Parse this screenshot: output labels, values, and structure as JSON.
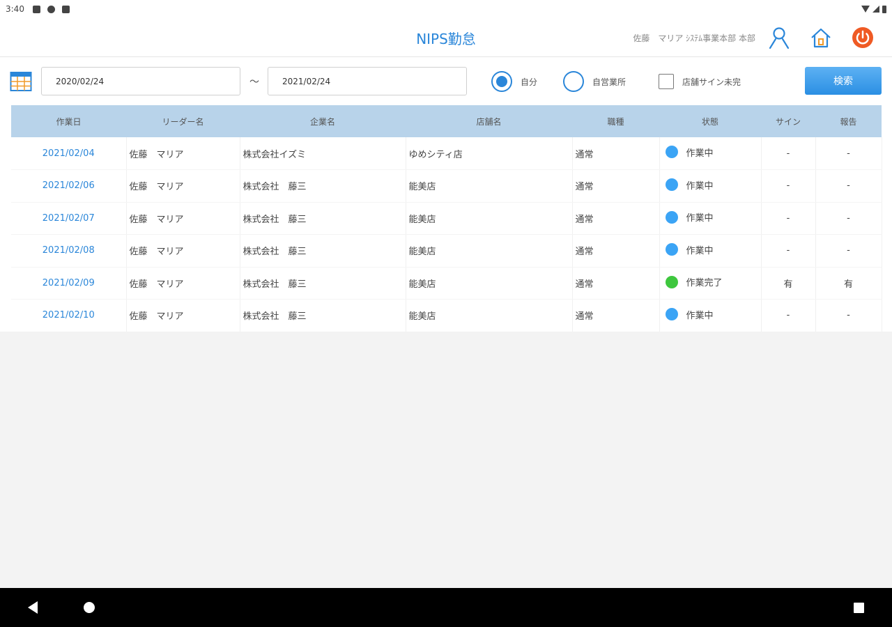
{
  "status_bar": {
    "time": "3:40"
  },
  "header": {
    "title": "NIPS勤怠",
    "user_info": "佐藤　マリア ｼｽﾃﾑ事業本部 本部"
  },
  "filter": {
    "date_from": "2020/02/24",
    "date_separator": "～",
    "date_to": "2021/02/24",
    "radio_self_label": "自分",
    "radio_office_label": "自営業所",
    "checkbox_label": "店舗サイン未完",
    "search_label": "検索"
  },
  "table": {
    "headers": [
      "作業日",
      "リーダー名",
      "企業名",
      "店舗名",
      "職種",
      "状態",
      "サイン",
      "報告"
    ],
    "rows": [
      {
        "date": "2021/02/04",
        "leader": "佐藤　マリア",
        "company": "株式会社イズミ",
        "store": "ゆめシティ店",
        "type": "通常",
        "status": "作業中",
        "sign": "-",
        "report": "-"
      },
      {
        "date": "2021/02/06",
        "leader": "佐藤　マリア",
        "company": "株式会社　藤三",
        "store": "能美店",
        "type": "通常",
        "status": "作業中",
        "sign": "-",
        "report": "-"
      },
      {
        "date": "2021/02/07",
        "leader": "佐藤　マリア",
        "company": "株式会社　藤三",
        "store": "能美店",
        "type": "通常",
        "status": "作業中",
        "sign": "-",
        "report": "-"
      },
      {
        "date": "2021/02/08",
        "leader": "佐藤　マリア",
        "company": "株式会社　藤三",
        "store": "能美店",
        "type": "通常",
        "status": "作業中",
        "sign": "-",
        "report": "-"
      },
      {
        "date": "2021/02/09",
        "leader": "佐藤　マリア",
        "company": "株式会社　藤三",
        "store": "能美店",
        "type": "通常",
        "status": "作業完了",
        "sign": "有",
        "report": "有"
      },
      {
        "date": "2021/02/10",
        "leader": "佐藤　マリア",
        "company": "株式会社　藤三",
        "store": "能美店",
        "type": "通常",
        "status": "作業中",
        "sign": "-",
        "report": "-"
      }
    ]
  },
  "colors": {
    "accent": "#2a86d9",
    "status_in_progress": "#3ba4f5",
    "status_done": "#3ec73e",
    "header_bg": "#b8d3ea",
    "power": "#ef5a24"
  }
}
